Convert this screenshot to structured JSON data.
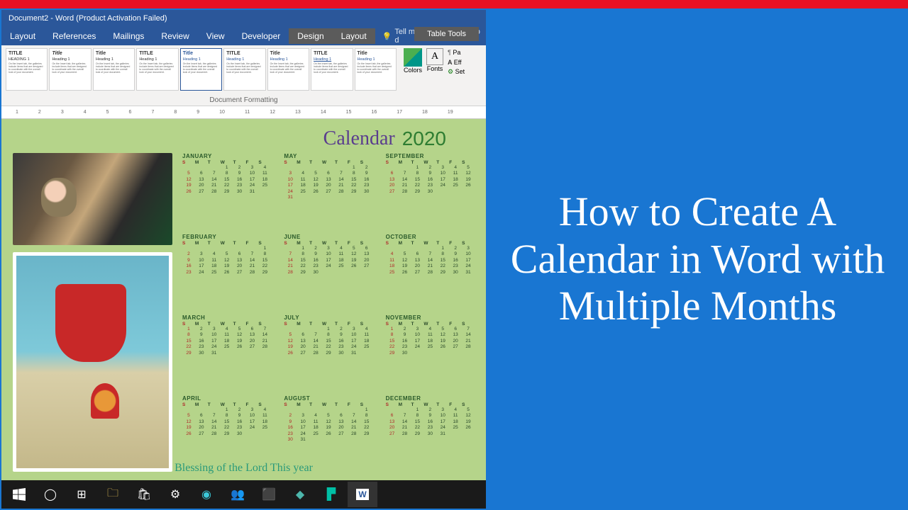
{
  "thumbnail": {
    "title": "How to Create A Calendar in Word with Multiple Months"
  },
  "word": {
    "title": "Document2 - Word (Product Activation Failed)",
    "context_group": "Table Tools",
    "tabs": [
      "Layout",
      "References",
      "Mailings",
      "Review",
      "View",
      "Developer",
      "Design",
      "Layout"
    ],
    "tell_me": "Tell me what you want to d",
    "ribbon_group": "Document Formatting",
    "colors_label": "Colors",
    "fonts_label": "Fonts",
    "opt_paragraph": "Pa",
    "opt_effects": "Eff",
    "opt_default": "Set",
    "style_preview": {
      "title_u": "TITLE",
      "title_i": "Title",
      "heading_caps": "HEADING 1",
      "heading": "Heading 1",
      "lorem": "On the Insert tab, the galleries include items that are designed to coordinate with the overall look of your document."
    }
  },
  "ruler_marks": [
    "1",
    "2",
    "3",
    "4",
    "5",
    "6",
    "7",
    "8",
    "9",
    "10",
    "11",
    "12",
    "13",
    "14",
    "15",
    "16",
    "17",
    "18",
    "19"
  ],
  "document": {
    "cal_word": "Calendar",
    "year": "2020",
    "blessing": "Blessing of the Lord This year",
    "dow": [
      "S",
      "M",
      "T",
      "W",
      "T",
      "F",
      "S"
    ],
    "months": [
      {
        "name": "JANUARY",
        "start": 3,
        "len": 31
      },
      {
        "name": "MAY",
        "start": 5,
        "len": 31
      },
      {
        "name": "SEPTEMBER",
        "start": 2,
        "len": 30
      },
      {
        "name": "FEBRUARY",
        "start": 6,
        "len": 29
      },
      {
        "name": "JUNE",
        "start": 1,
        "len": 30
      },
      {
        "name": "OCTOBER",
        "start": 4,
        "len": 31
      },
      {
        "name": "MARCH",
        "start": 0,
        "len": 31
      },
      {
        "name": "JULY",
        "start": 3,
        "len": 31
      },
      {
        "name": "NOVEMBER",
        "start": 0,
        "len": 30
      },
      {
        "name": "APRIL",
        "start": 3,
        "len": 30
      },
      {
        "name": "AUGUST",
        "start": 6,
        "len": 31
      },
      {
        "name": "DECEMBER",
        "start": 2,
        "len": 31
      }
    ]
  },
  "taskbar": {
    "items": [
      "windows",
      "search",
      "task-view",
      "explorer",
      "store",
      "settings",
      "edge",
      "teams",
      "office",
      "vscode",
      "filmora",
      "word"
    ]
  }
}
